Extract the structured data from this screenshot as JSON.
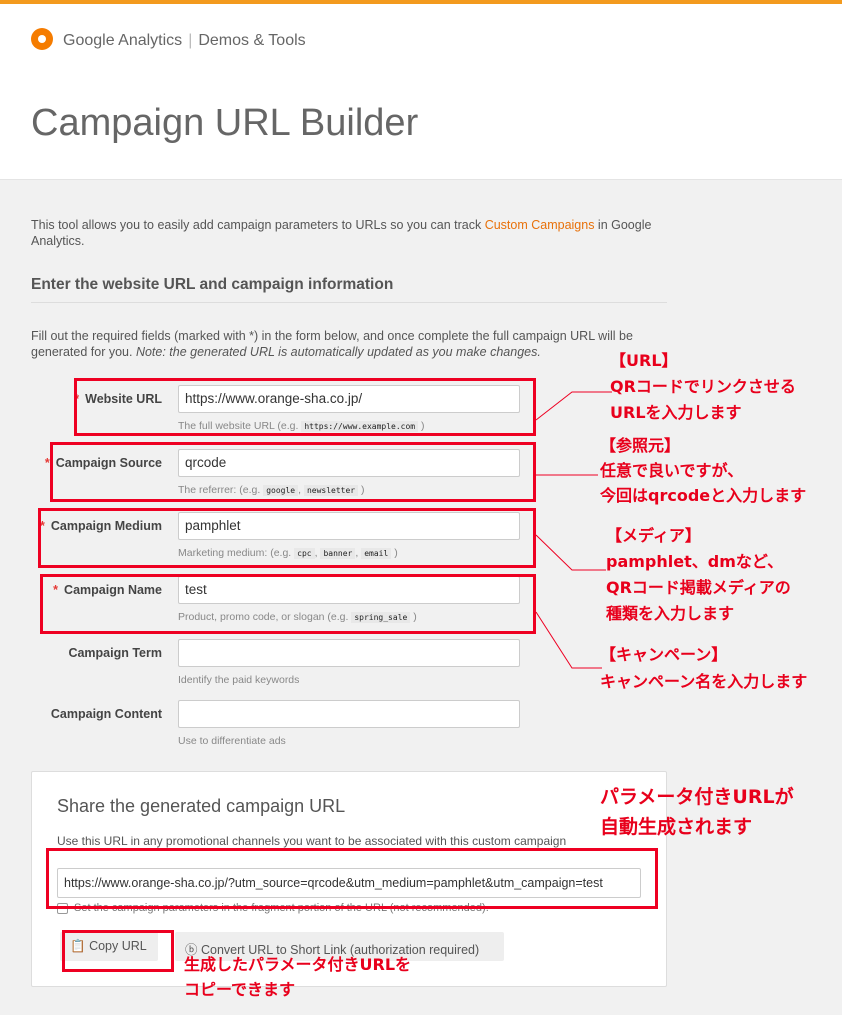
{
  "header": {
    "brand": "Google Analytics",
    "product": "Demos & Tools",
    "title": "Campaign URL Builder"
  },
  "intro": {
    "text_before": "This tool allows you to easily add campaign parameters to URLs so you can track ",
    "link": "Custom Campaigns",
    "text_after": " in Google Analytics."
  },
  "section_title": "Enter the website URL and campaign information",
  "fill_text": "Fill out the required fields (marked with *) in the form below, and once complete the full campaign URL will be generated for you.",
  "fill_note": "Note: the generated URL is automatically updated as you make changes.",
  "fields": [
    {
      "label": "Website URL",
      "required": true,
      "value": "https://www.orange-sha.co.jp/",
      "help": "The full website URL (e.g. ",
      "codes": [
        "https://www.example.com"
      ]
    },
    {
      "label": "Campaign Source",
      "required": true,
      "value": "qrcode",
      "help": "The referrer: (e.g. ",
      "codes": [
        "google",
        "newsletter"
      ]
    },
    {
      "label": "Campaign Medium",
      "required": true,
      "value": "pamphlet",
      "help": "Marketing medium: (e.g. ",
      "codes": [
        "cpc",
        "banner",
        "email"
      ]
    },
    {
      "label": "Campaign Name",
      "required": true,
      "value": "test",
      "help": "Product, promo code, or slogan (e.g. ",
      "codes": [
        "spring_sale"
      ]
    },
    {
      "label": "Campaign Term",
      "required": false,
      "value": "",
      "help": "Identify the paid keywords",
      "codes": []
    },
    {
      "label": "Campaign Content",
      "required": false,
      "value": "",
      "help": "Use to differentiate ads",
      "codes": []
    }
  ],
  "share": {
    "title": "Share the generated campaign URL",
    "desc": "Use this URL in any promotional channels you want to be associated with this custom campaign",
    "url": "https://www.orange-sha.co.jp/?utm_source=qrcode&utm_medium=pamphlet&utm_campaign=test",
    "checkbox": "Set the campaign parameters in the fragment portion of the URL (not recommended).",
    "checked": false,
    "copy": "Copy URL",
    "convert": "Convert URL to Short Link (authorization required)"
  },
  "annotations": {
    "url": [
      "【URL】",
      "QRコードでリンクさせる",
      "URLを入力します"
    ],
    "source": [
      "【参照元】",
      "任意で良いですが、",
      "今回はqrcodeと入力します"
    ],
    "medium": [
      "【メディア】",
      "pamphlet、dmなど、",
      "QRコード掲載メディアの",
      "種類を入力します"
    ],
    "name": [
      "【キャンペーン】",
      "キャンペーン名を入力します"
    ],
    "generated": [
      "パラメータ付きURLが",
      "自動生成されます"
    ],
    "copy": [
      "生成したパラメータ付きURLを",
      "コピーできます"
    ]
  },
  "colors": {
    "accent": "#f39a1e",
    "link": "#e8710a",
    "annotation": "#ee0022"
  }
}
